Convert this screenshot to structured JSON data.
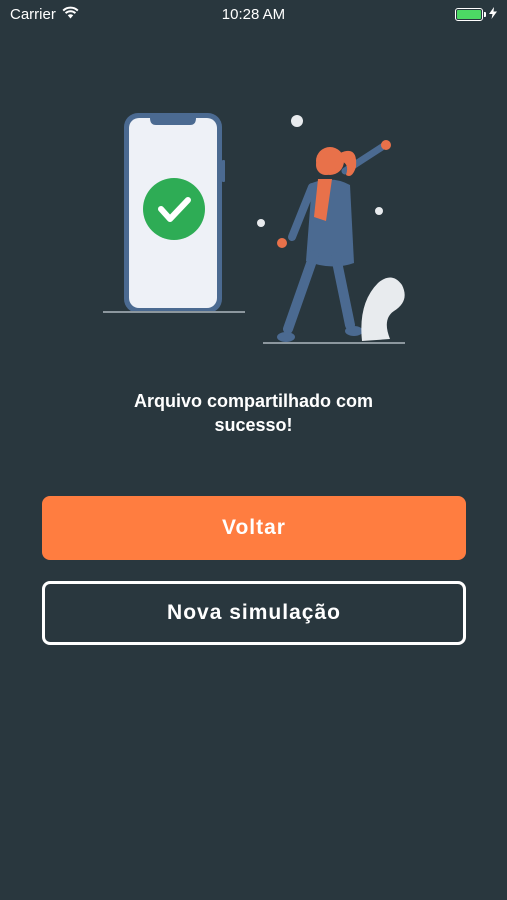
{
  "status_bar": {
    "carrier": "Carrier",
    "time": "10:28 AM",
    "icons": [
      "wifi-icon",
      "battery-icon",
      "charging-bolt-icon"
    ]
  },
  "illustration": {
    "name": "success-share-illustration",
    "colors": {
      "check": "#2eac55",
      "phone_screen": "#eef1f7",
      "phone_frame": "#4b6a91",
      "figure_body": "#4b6a91",
      "hair": "#e8714a"
    }
  },
  "message": {
    "text": "Arquivo compartilhado com sucesso!"
  },
  "buttons": {
    "back_label": "Voltar",
    "new_simulation_label": "Nova simulação"
  },
  "colors": {
    "background": "#29373e",
    "accent": "#ff7d40",
    "text": "#ffffff"
  }
}
